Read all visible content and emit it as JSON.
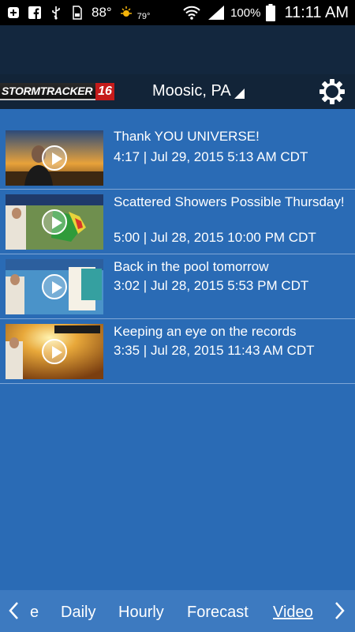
{
  "status_bar": {
    "temperature": "88°",
    "feels_like": "79°",
    "battery": "100%",
    "time": "11:11 AM"
  },
  "app_bar": {
    "logo_text": "STORMTRACKER",
    "logo_number": "16",
    "location": "Moosic, PA"
  },
  "videos": [
    {
      "title": "Thank YOU UNIVERSE!",
      "meta": "4:17 | Jul 29, 2015 5:13 AM CDT"
    },
    {
      "title": "Scattered Showers Possible Thursday!",
      "meta": "5:00 | Jul 28, 2015 10:00 PM CDT"
    },
    {
      "title": "Back in the pool tomorrow",
      "meta": "3:02 | Jul 28, 2015 5:53 PM CDT"
    },
    {
      "title": "Keeping an eye on the records",
      "meta": "3:35 | Jul 28, 2015 11:43 AM CDT"
    }
  ],
  "tabs": {
    "prev_partial": "e",
    "daily": "Daily",
    "hourly": "Hourly",
    "forecast": "Forecast",
    "video": "Video",
    "active": "Video"
  },
  "colors": {
    "background": "#2a6bb5",
    "app_bar": "#122438",
    "tab_bar": "#3d7ac0"
  }
}
